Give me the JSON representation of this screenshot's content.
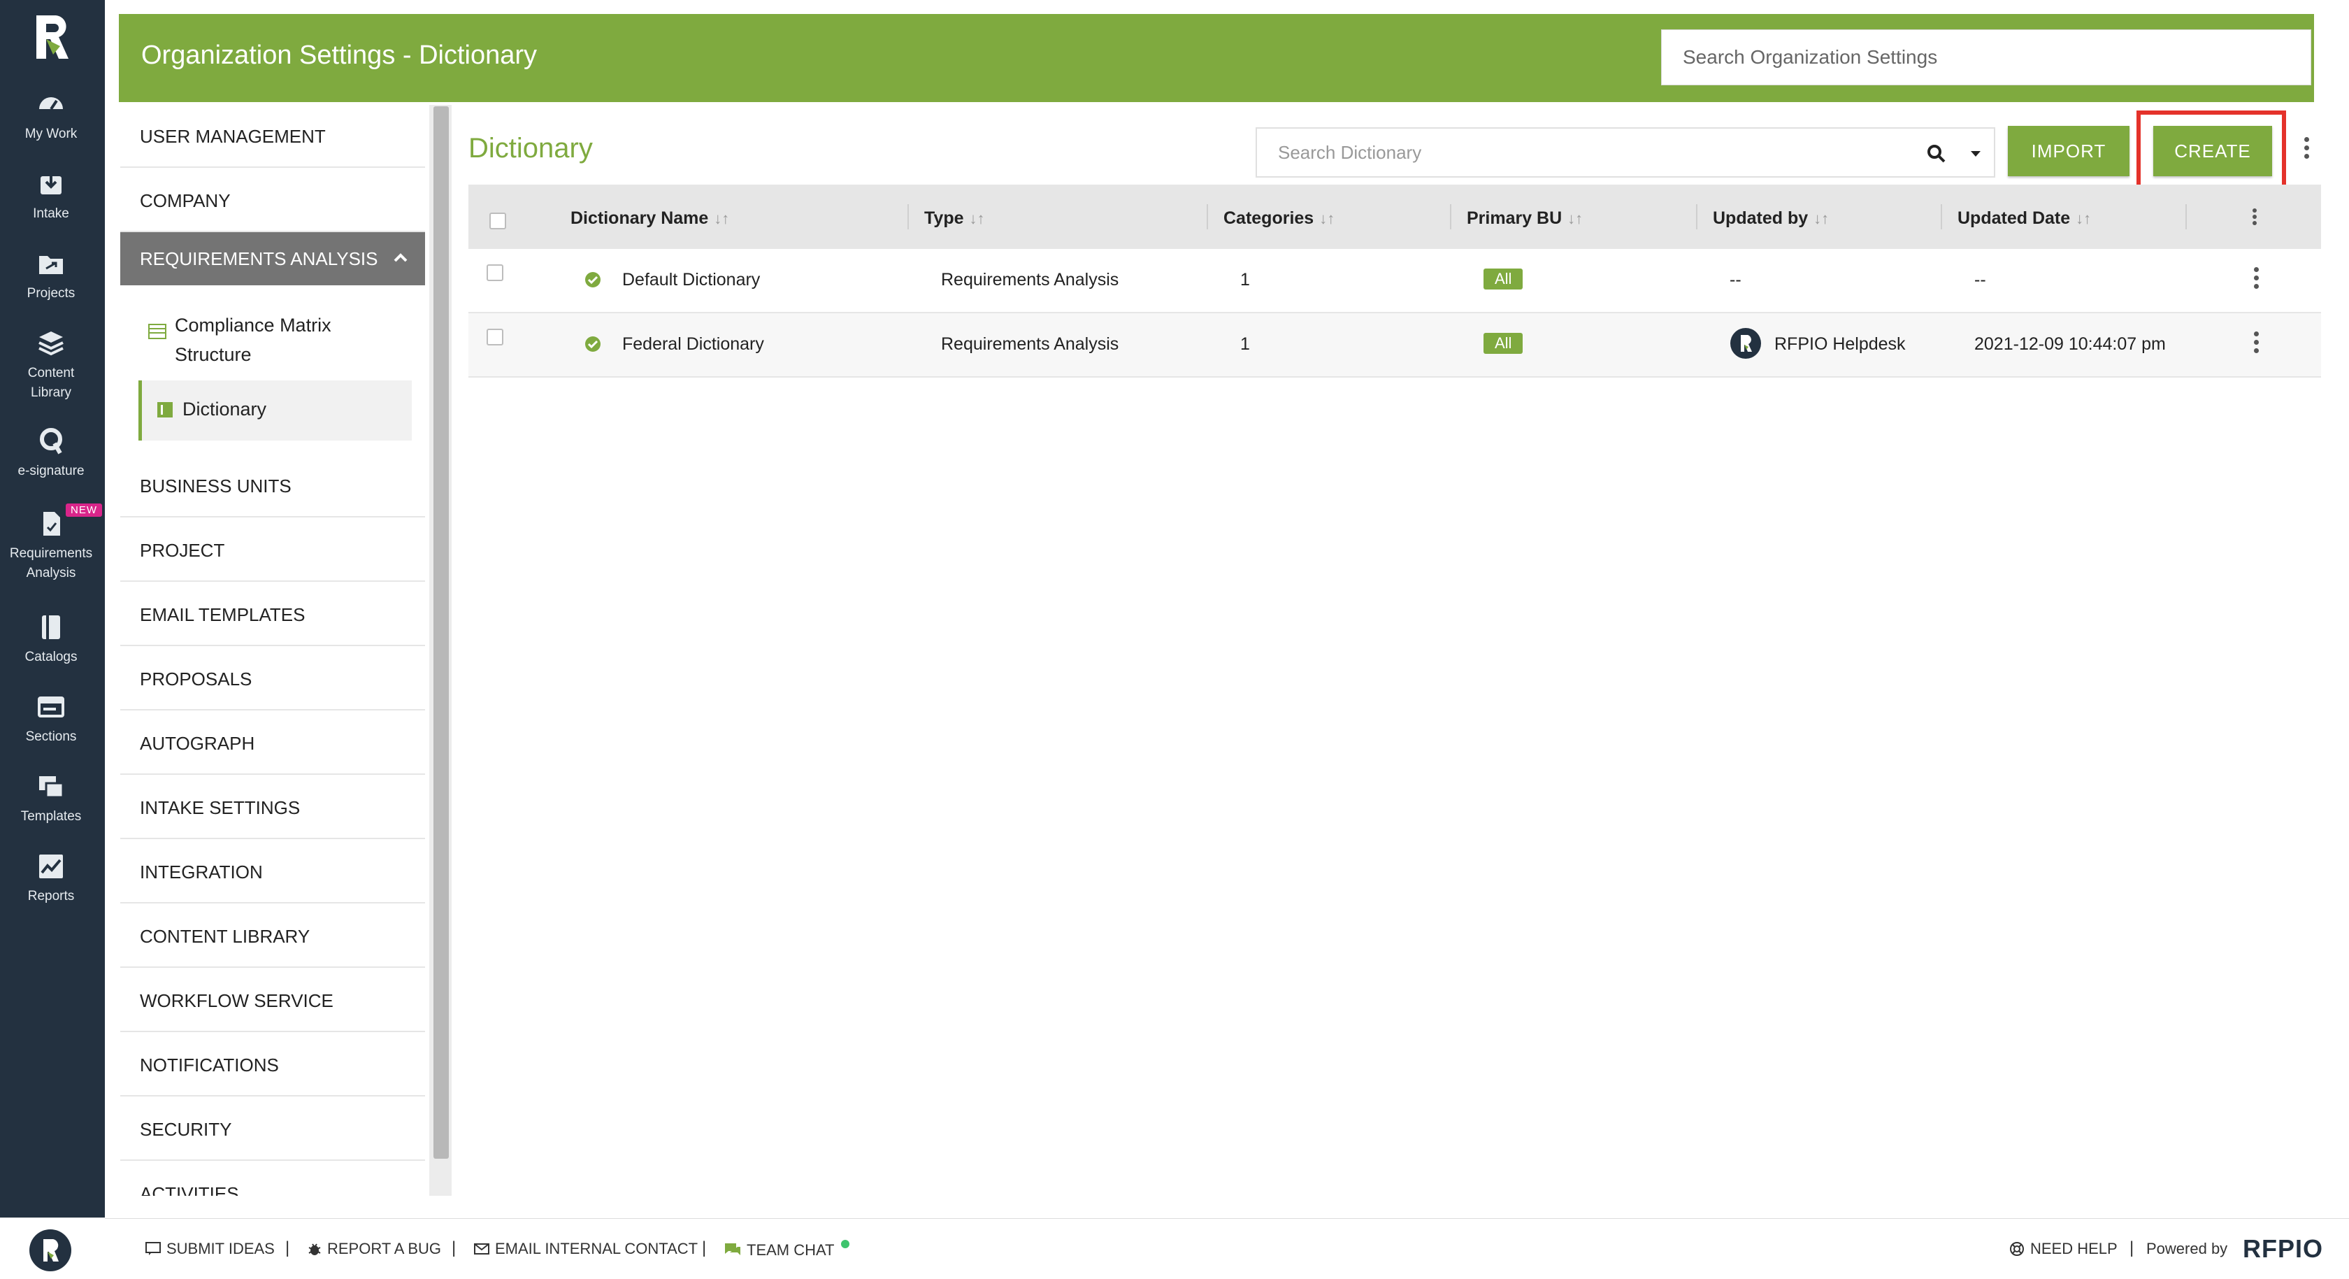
{
  "nav": {
    "items": [
      {
        "label": "My Work",
        "icon": "dashboard-icon"
      },
      {
        "label": "Intake",
        "icon": "intake-icon"
      },
      {
        "label": "Projects",
        "icon": "projects-icon"
      },
      {
        "label_lines": [
          "Content",
          "Library"
        ],
        "icon": "content-library-icon"
      },
      {
        "label": "e-signature",
        "icon": "e-signature-icon"
      },
      {
        "label_lines": [
          "Requirements",
          "Analysis"
        ],
        "icon": "requirements-analysis-icon",
        "badge": "NEW"
      },
      {
        "label": "Catalogs",
        "icon": "catalogs-icon"
      },
      {
        "label": "Sections",
        "icon": "sections-icon"
      },
      {
        "label": "Templates",
        "icon": "templates-icon"
      },
      {
        "label": "Reports",
        "icon": "reports-icon"
      }
    ]
  },
  "header": {
    "title": "Organization Settings - Dictionary",
    "search_placeholder": "Search Organization Settings"
  },
  "menu": {
    "items": [
      "USER MANAGEMENT",
      "COMPANY",
      "REQUIREMENTS ANALYSIS",
      "BUSINESS UNITS",
      "PROJECT",
      "EMAIL TEMPLATES",
      "PROPOSALS",
      "AUTOGRAPH",
      "INTAKE SETTINGS",
      "INTEGRATION",
      "CONTENT LIBRARY",
      "WORKFLOW SERVICE",
      "NOTIFICATIONS",
      "SECURITY",
      "ACTIVITIES"
    ],
    "sub_items": [
      {
        "lines": [
          "Compliance Matrix",
          "Structure"
        ]
      },
      {
        "lines": [
          "Dictionary"
        ]
      }
    ]
  },
  "main": {
    "title": "Dictionary",
    "search_placeholder": "Search Dictionary",
    "import_label": "IMPORT",
    "create_label": "CREATE"
  },
  "table": {
    "columns": [
      "Dictionary Name",
      "Type",
      "Categories",
      "Primary BU",
      "Updated by",
      "Updated Date"
    ],
    "sort_glyph": "↓↑",
    "rows": [
      {
        "name": "Default Dictionary",
        "type": "Requirements Analysis",
        "categories": "1",
        "bu": "All",
        "updated_by": "--",
        "updated_date": "--"
      },
      {
        "name": "Federal Dictionary",
        "type": "Requirements Analysis",
        "categories": "1",
        "bu": "All",
        "updated_by": "RFPIO Helpdesk",
        "updated_date": "2021-12-09 10:44:07 pm"
      }
    ]
  },
  "footer": {
    "submit_ideas": "SUBMIT IDEAS",
    "report_bug": "REPORT A BUG",
    "email_contact": "EMAIL INTERNAL CONTACT",
    "team_chat": "TEAM CHAT",
    "need_help": "NEED HELP",
    "powered_by": "Powered by",
    "brand": "RFPIO",
    "separator": "|"
  },
  "colors": {
    "brand_green": "#7faa3f",
    "rail_dark": "#233140",
    "highlight_red": "#e4322b",
    "badge_pink": "#d9258a"
  }
}
